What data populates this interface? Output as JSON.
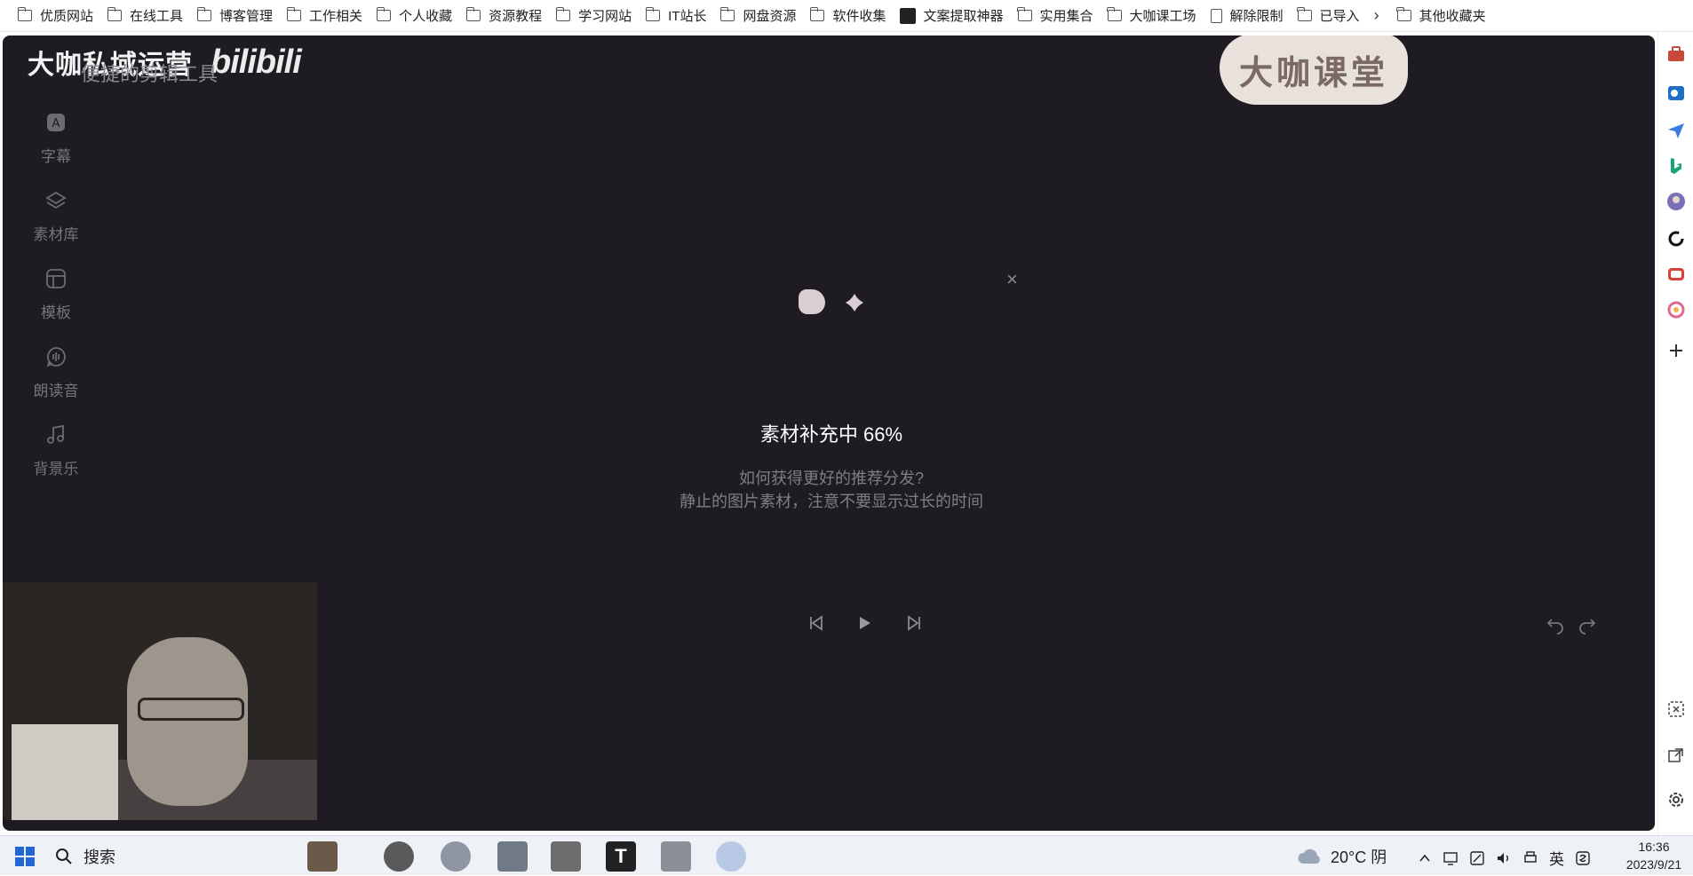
{
  "bookmarks": [
    {
      "label": "优质网站",
      "icon": "folder-icon"
    },
    {
      "label": "在线工具",
      "icon": "folder-icon"
    },
    {
      "label": "博客管理",
      "icon": "folder-icon"
    },
    {
      "label": "工作相关",
      "icon": "folder-icon"
    },
    {
      "label": "个人收藏",
      "icon": "folder-icon"
    },
    {
      "label": "资源教程",
      "icon": "folder-icon"
    },
    {
      "label": "学习网站",
      "icon": "folder-icon"
    },
    {
      "label": "IT站长",
      "icon": "folder-icon"
    },
    {
      "label": "网盘资源",
      "icon": "folder-icon"
    },
    {
      "label": "软件收集",
      "icon": "folder-icon"
    },
    {
      "label": "文案提取神器",
      "icon": "app-icon"
    },
    {
      "label": "实用集合",
      "icon": "folder-icon"
    },
    {
      "label": "大咖课工场",
      "icon": "folder-icon"
    },
    {
      "label": "解除限制",
      "icon": "doc-icon"
    },
    {
      "label": "已导入",
      "icon": "folder-icon"
    }
  ],
  "bookmarks_overflow": "›",
  "other_bookmarks": "其他收藏夹",
  "app": {
    "brand": "大咖私域运营",
    "brand_ghost": "便捷的剪辑工具",
    "bili_logo": "bilibili",
    "watermark": "大咖课堂",
    "nav": [
      {
        "label": "字幕",
        "icon": "subtitle-icon"
      },
      {
        "label": "素材库",
        "icon": "layers-icon"
      },
      {
        "label": "模板",
        "icon": "template-icon"
      },
      {
        "label": "朗读音",
        "icon": "voice-icon"
      },
      {
        "label": "背景乐",
        "icon": "music-note-icon"
      }
    ],
    "close_label": "×",
    "progress_label": "素材补充中 66%",
    "progress_percent": 66,
    "tip_line1": "如何获得更好的推荐分发?",
    "tip_line2": "静止的图片素材，注意不要显示过长的时间"
  },
  "taskbar": {
    "search_placeholder": "搜索",
    "weather": "20°C 阴",
    "ime": "英",
    "time": "16:36",
    "date": "2023/9/21"
  },
  "colors": {
    "app_bg": "#1e1b22",
    "accent": "#ffffff",
    "muted": "#807d85"
  }
}
